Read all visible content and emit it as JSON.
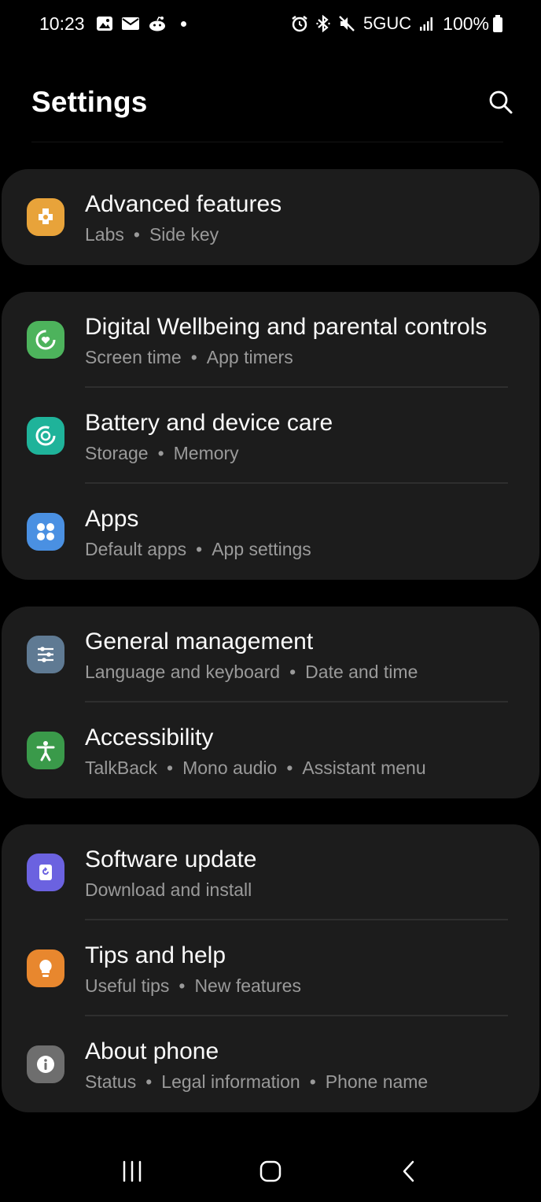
{
  "status_bar": {
    "time": "10:23",
    "network": "5GUC",
    "battery": "100%",
    "left_icons": [
      "gallery-icon",
      "mail-icon",
      "reddit-icon",
      "notification-dot"
    ],
    "right_icons": [
      "alarm-icon",
      "bluetooth-icon",
      "mute-icon",
      "signal-icon",
      "battery-icon"
    ]
  },
  "header": {
    "title": "Settings",
    "search_icon": "search-icon"
  },
  "groups": [
    {
      "items": [
        {
          "title": "Advanced features",
          "sub": [
            "Labs",
            "Side key"
          ],
          "icon": "puzzle-icon",
          "color": "#e8a33a"
        }
      ]
    },
    {
      "items": [
        {
          "title": "Digital Wellbeing and parental controls",
          "sub": [
            "Screen time",
            "App timers"
          ],
          "icon": "wellbeing-icon",
          "color": "#4db35c"
        },
        {
          "title": "Battery and device care",
          "sub": [
            "Storage",
            "Memory"
          ],
          "icon": "device-care-icon",
          "color": "#1fb39a"
        },
        {
          "title": "Apps",
          "sub": [
            "Default apps",
            "App settings"
          ],
          "icon": "apps-icon",
          "color": "#4a90e2"
        }
      ]
    },
    {
      "items": [
        {
          "title": "General management",
          "sub": [
            "Language and keyboard",
            "Date and time"
          ],
          "icon": "sliders-icon",
          "color": "#5f7a93"
        },
        {
          "title": "Accessibility",
          "sub": [
            "TalkBack",
            "Mono audio",
            "Assistant menu"
          ],
          "icon": "accessibility-icon",
          "color": "#3a9a4a"
        }
      ]
    },
    {
      "items": [
        {
          "title": "Software update",
          "sub": [
            "Download and install"
          ],
          "icon": "update-icon",
          "color": "#6b62e0"
        },
        {
          "title": "Tips and help",
          "sub": [
            "Useful tips",
            "New features"
          ],
          "icon": "lightbulb-icon",
          "color": "#e8872e"
        },
        {
          "title": "About phone",
          "sub": [
            "Status",
            "Legal information",
            "Phone name"
          ],
          "icon": "info-icon",
          "color": "#6e6e6e"
        }
      ]
    }
  ],
  "nav_bar": {
    "recents_icon": "recents-icon",
    "home_icon": "home-icon",
    "back_icon": "back-icon"
  }
}
